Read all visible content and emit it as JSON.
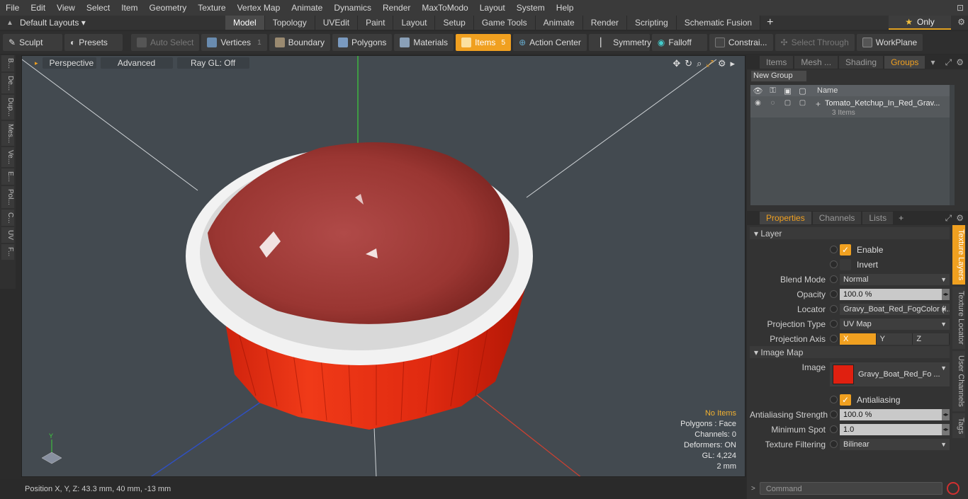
{
  "menu": [
    "File",
    "Edit",
    "View",
    "Select",
    "Item",
    "Geometry",
    "Texture",
    "Vertex Map",
    "Animate",
    "Dynamics",
    "Render",
    "MaxToModo",
    "Layout",
    "System",
    "Help"
  ],
  "layout": {
    "selector": "Default Layouts",
    "tabs": [
      "Model",
      "Topology",
      "UVEdit",
      "Paint",
      "Layout",
      "Setup",
      "Game Tools",
      "Animate",
      "Render",
      "Scripting",
      "Schematic Fusion"
    ],
    "active_tab": "Model",
    "only_label": "Only"
  },
  "toolbar": {
    "sculpt": "Sculpt",
    "presets": "Presets",
    "auto_select": "Auto Select",
    "vertices": "Vertices",
    "vertices_count": "1",
    "boundary": "Boundary",
    "polygons": "Polygons",
    "materials": "Materials",
    "items": "Items",
    "items_count": "5",
    "action_center": "Action Center",
    "symmetry": "Symmetry",
    "falloff": "Falloff",
    "constraints": "Constrai...",
    "select_through": "Select Through",
    "workplane": "WorkPlane"
  },
  "left_tabs": [
    "B...",
    "De...",
    "Dup...",
    "Mes...",
    "Ve...",
    "E...",
    "Pol...",
    "C...",
    "UV",
    "F..."
  ],
  "viewport": {
    "perspective": "Perspective",
    "advanced": "Advanced",
    "raygl": "Ray GL: Off",
    "stats": {
      "items": "No Items",
      "polygons": "Polygons : Face",
      "channels": "Channels: 0",
      "deformers": "Deformers: ON",
      "gl": "GL: 4,224",
      "unit": "2 mm"
    },
    "axis_labels": {
      "y": "Y"
    }
  },
  "status": {
    "position": "Position X, Y, Z:   43.3 mm, 40 mm, -13 mm"
  },
  "groups_panel": {
    "tabs": [
      "Items",
      "Mesh ...",
      "Shading",
      "Groups"
    ],
    "active_tab": "Groups",
    "new_group": "New Group",
    "column_name": "Name",
    "row": {
      "name": "Tomato_Ketchup_In_Red_Grav...",
      "sub": "3 Items"
    }
  },
  "properties_panel": {
    "tabs": [
      "Properties",
      "Channels",
      "Lists"
    ],
    "active_tab": "Properties",
    "layer_section": "Layer",
    "enable": "Enable",
    "invert": "Invert",
    "blend_mode_label": "Blend Mode",
    "blend_mode": "Normal",
    "opacity_label": "Opacity",
    "opacity": "100.0 %",
    "locator_label": "Locator",
    "locator": "Gravy_Boat_Red_FogColor (I...",
    "projection_type_label": "Projection Type",
    "projection_type": "UV Map",
    "projection_axis_label": "Projection Axis",
    "axes": [
      "X",
      "Y",
      "Z"
    ],
    "image_map_section": "Image Map",
    "image_label": "Image",
    "image_name": "Gravy_Boat_Red_Fo ...",
    "antialiasing": "Antialiasing",
    "aa_strength_label": "Antialiasing Strength",
    "aa_strength": "100.0 %",
    "min_spot_label": "Minimum Spot",
    "min_spot": "1.0",
    "tex_filter_label": "Texture Filtering",
    "tex_filter": "Bilinear",
    "more": ">>"
  },
  "right_vtabs": [
    "Texture Layers",
    "Texture Locator",
    "User Channels",
    "Tags"
  ],
  "command": {
    "placeholder": "Command"
  },
  "colors": {
    "accent": "#f0a020",
    "viewport_bg": "#434a50",
    "bowl_red": "#e02010"
  }
}
